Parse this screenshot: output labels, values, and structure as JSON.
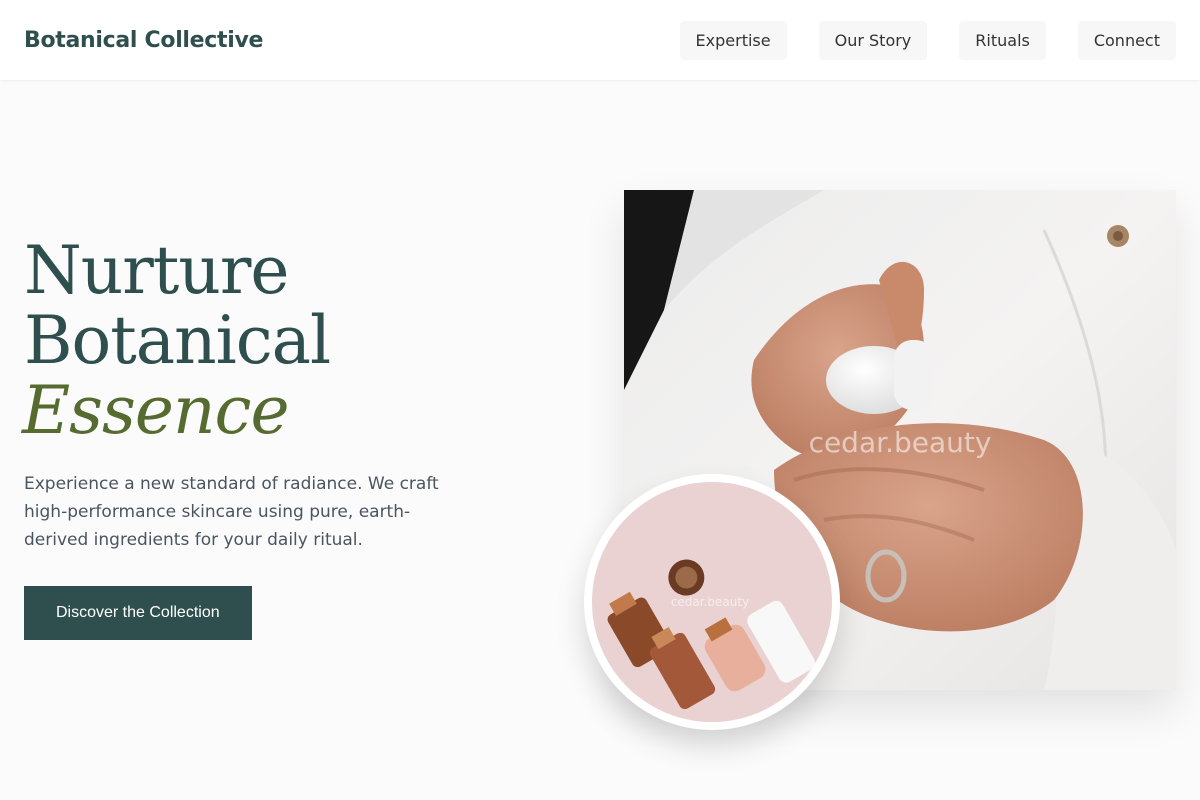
{
  "header": {
    "brand": "Botanical Collective",
    "nav": [
      "Expertise",
      "Our Story",
      "Rituals",
      "Connect"
    ]
  },
  "hero": {
    "headline_line1": "Nurture",
    "headline_line2": "Botanical",
    "headline_accent": "Essence",
    "description": "Experience a new standard of radiance. We craft high-performance skincare using pure, earth-derived ingredients for your daily ritual.",
    "cta_label": "Discover the Collection"
  },
  "images": {
    "main_watermark": "cedar.beauty",
    "inset_watermark": "cedar.beauty"
  },
  "colors": {
    "primary": "#2f4f4f",
    "accent": "#556b2f",
    "background": "#fbfbfb"
  }
}
